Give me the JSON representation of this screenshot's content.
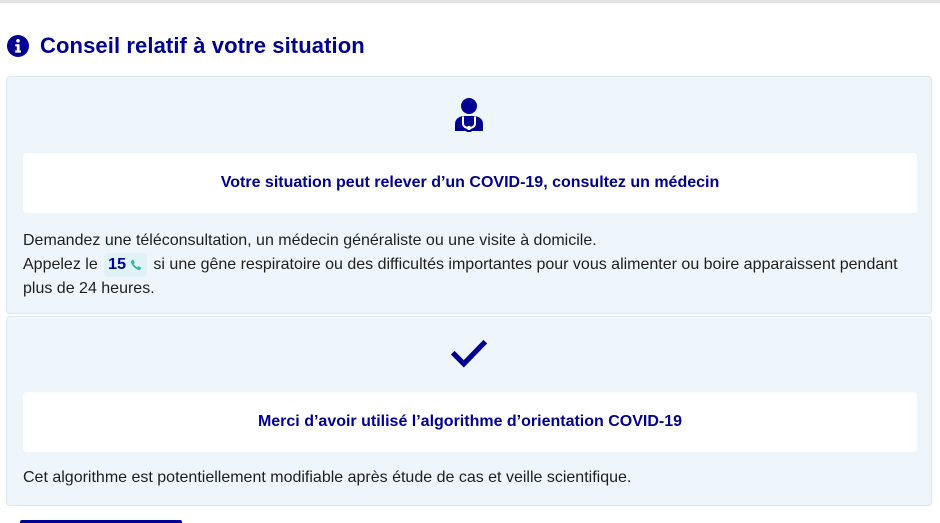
{
  "section": {
    "title": "Conseil relatif à votre situation",
    "icon": "info-icon"
  },
  "cards": [
    {
      "icon": "doctor-icon",
      "notice": "Votre situation peut relever d’un COVID-19, consultez un médecin",
      "line1": "Demandez une téléconsultation, un médecin généraliste ou une visite à domicile.",
      "line2_before": "Appelez le",
      "phone_number": "15",
      "phone_icon": "phone-icon",
      "line2_after": "si une gêne respiratoire ou des difficultés importantes pour vous alimenter ou boire apparaissent pendant plus de 24 heures."
    },
    {
      "icon": "checkmark-icon",
      "notice": "Merci d’avoir utilisé l’algorithme d’orientation COVID-19",
      "text": "Cet algorithme est potentiellement modifiable après étude de cas et veille scientifique."
    }
  ],
  "colors": {
    "primary": "#000091",
    "card_background": "#eef6fc",
    "phone_background": "#dff3f7",
    "text": "#1e1e1e"
  }
}
